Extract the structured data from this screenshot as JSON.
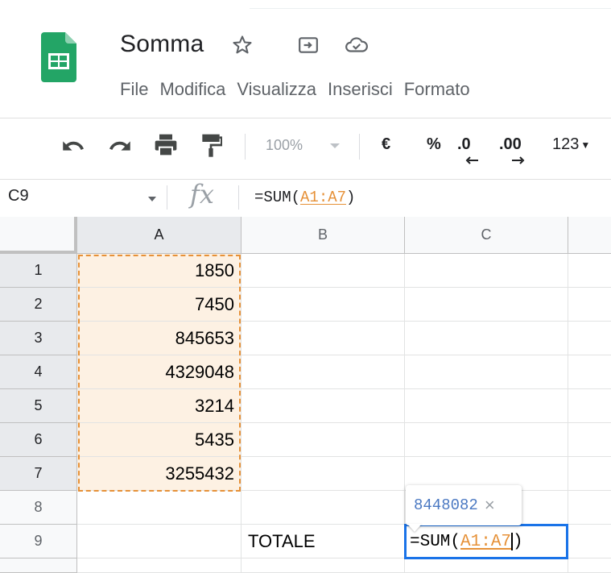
{
  "document": {
    "title": "Somma"
  },
  "menu": [
    "File",
    "Modifica",
    "Visualizza",
    "Inserisci",
    "Formato"
  ],
  "toolbar": {
    "zoom": "100%",
    "currency": "€",
    "percent": "%",
    "dec_decrease": ".0",
    "dec_increase": ".00",
    "more_formats": "123"
  },
  "formula_bar": {
    "name_box": "C9",
    "fx": "fx",
    "prefix": "=SUM(",
    "ref": "A1:A7",
    "suffix": ")"
  },
  "columns": [
    "A",
    "B",
    "C"
  ],
  "rows": [
    "1",
    "2",
    "3",
    "4",
    "5",
    "6",
    "7",
    "8",
    "9"
  ],
  "cells": {
    "A": [
      "1850",
      "7450",
      "845653",
      "4329048",
      "3214",
      "5435",
      "3255432"
    ],
    "B9": "TOTALE"
  },
  "active_cell": {
    "prefix": "=SUM(",
    "ref": "A1:A7",
    "suffix": ")"
  },
  "tooltip": {
    "value": "8448082",
    "close": "×"
  },
  "colors": {
    "accent": "#1a73e8",
    "range": "#e69138",
    "range_fill": "#fdf1e3",
    "sheets_green": "#0f9d58"
  }
}
